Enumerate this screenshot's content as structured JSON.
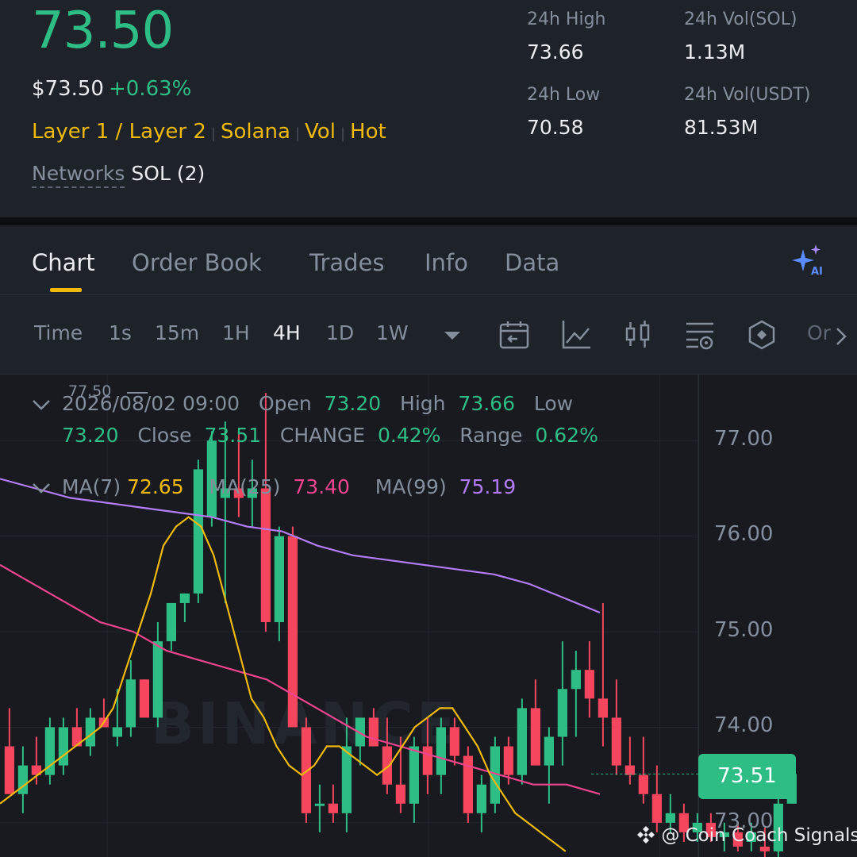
{
  "header": {
    "price": "73.50",
    "price_usd": "$73.50",
    "change_pct": "+0.63%",
    "tags": [
      "Layer 1 / Layer 2",
      "Solana",
      "Vol",
      "Hot"
    ],
    "tag_separator": "|",
    "networks_label": "Networks",
    "networks_value": "SOL (2)",
    "stats": {
      "high_label": "24h High",
      "high_value": "73.66",
      "low_label": "24h Low",
      "low_value": "70.58",
      "vol_sol_label": "24h Vol(SOL)",
      "vol_sol_value": "1.13M",
      "vol_usdt_label": "24h Vol(USDT)",
      "vol_usdt_value": "81.53M"
    }
  },
  "tabs": [
    "Chart",
    "Order Book",
    "Trades",
    "Info",
    "Data"
  ],
  "active_tab": "Chart",
  "timeframes": {
    "label": "Time",
    "items": [
      "1s",
      "15m",
      "1H",
      "4H",
      "1D",
      "1W"
    ],
    "active": "4H",
    "more": "Or"
  },
  "tool_icons": [
    "calendar-icon",
    "line-chart-icon",
    "candle-icon",
    "indicator-settings-icon",
    "hexagon-icon"
  ],
  "ohlc": {
    "date": "2026/08/02 09:00",
    "open_label": "Open",
    "open": "73.20",
    "high_label": "High",
    "high": "73.66",
    "low_label": "Low",
    "low": "73.20",
    "close_label": "Close",
    "close": "73.51",
    "change_label": "CHANGE",
    "change": "0.42%",
    "range_label": "Range",
    "range": "0.62%"
  },
  "ma": {
    "ma7_label": "MA(7)",
    "ma7": "72.65",
    "ma25_label": "MA(25)",
    "ma25": "73.40",
    "ma99_label": "MA(99)",
    "ma99": "75.19"
  },
  "colors": {
    "up": "#2ebd85",
    "down": "#f6465d",
    "accent": "#f0b90b",
    "ma7": "#f0b90b",
    "ma25": "#f0448e",
    "ma99": "#b27cf7",
    "background": "#1e2329",
    "chart_bg": "#181a20"
  },
  "watermark": "BINANCE",
  "credit": "@ Coin Coach Signals",
  "chart_data": {
    "type": "candlestick",
    "y_axis_ticks": [
      "77.00",
      "76.00",
      "75.00",
      "74.00",
      "73.00"
    ],
    "ylim": [
      72.7,
      77.7
    ],
    "high_marker": "77.50",
    "current_price": "73.51",
    "candles": [
      {
        "o": 73.8,
        "h": 74.2,
        "l": 73.3,
        "c": 73.3
      },
      {
        "o": 73.3,
        "h": 73.8,
        "l": 73.1,
        "c": 73.6
      },
      {
        "o": 73.6,
        "h": 73.9,
        "l": 73.4,
        "c": 73.5
      },
      {
        "o": 73.5,
        "h": 74.1,
        "l": 73.4,
        "c": 74.0
      },
      {
        "o": 73.6,
        "h": 74.1,
        "l": 73.5,
        "c": 74.0
      },
      {
        "o": 74.0,
        "h": 74.2,
        "l": 73.8,
        "c": 73.8
      },
      {
        "o": 73.8,
        "h": 74.2,
        "l": 73.7,
        "c": 74.1
      },
      {
        "o": 74.1,
        "h": 74.3,
        "l": 74.0,
        "c": 74.0
      },
      {
        "o": 73.9,
        "h": 74.4,
        "l": 73.8,
        "c": 74.0
      },
      {
        "o": 74.0,
        "h": 74.7,
        "l": 73.9,
        "c": 74.5
      },
      {
        "o": 74.5,
        "h": 74.5,
        "l": 74.1,
        "c": 74.1
      },
      {
        "o": 74.1,
        "h": 75.1,
        "l": 74.0,
        "c": 74.9
      },
      {
        "o": 74.9,
        "h": 75.3,
        "l": 74.8,
        "c": 75.3
      },
      {
        "o": 75.3,
        "h": 75.4,
        "l": 75.1,
        "c": 75.4
      },
      {
        "o": 75.4,
        "h": 76.8,
        "l": 75.3,
        "c": 76.7
      },
      {
        "o": 76.2,
        "h": 77.1,
        "l": 76.1,
        "c": 77.0
      },
      {
        "o": 76.4,
        "h": 77.2,
        "l": 75.3,
        "c": 76.5
      },
      {
        "o": 76.5,
        "h": 77.1,
        "l": 76.2,
        "c": 76.4
      },
      {
        "o": 76.4,
        "h": 76.8,
        "l": 76.1,
        "c": 76.5
      },
      {
        "o": 76.5,
        "h": 77.5,
        "l": 75.0,
        "c": 75.1
      },
      {
        "o": 75.1,
        "h": 76.1,
        "l": 74.9,
        "c": 76.0
      },
      {
        "o": 76.0,
        "h": 76.1,
        "l": 74.0,
        "c": 74.0
      },
      {
        "o": 74.0,
        "h": 74.1,
        "l": 73.0,
        "c": 73.1
      },
      {
        "o": 73.2,
        "h": 73.4,
        "l": 72.9,
        "c": 73.2
      },
      {
        "o": 73.2,
        "h": 73.4,
        "l": 73.0,
        "c": 73.1
      },
      {
        "o": 73.1,
        "h": 74.1,
        "l": 72.9,
        "c": 73.8
      },
      {
        "o": 73.8,
        "h": 74.1,
        "l": 73.6,
        "c": 74.1
      },
      {
        "o": 74.1,
        "h": 74.2,
        "l": 73.8,
        "c": 73.8
      },
      {
        "o": 73.8,
        "h": 74.1,
        "l": 73.3,
        "c": 73.4
      },
      {
        "o": 73.4,
        "h": 73.9,
        "l": 73.1,
        "c": 73.2
      },
      {
        "o": 73.2,
        "h": 73.9,
        "l": 73.0,
        "c": 73.8
      },
      {
        "o": 73.8,
        "h": 74.1,
        "l": 73.3,
        "c": 73.5
      },
      {
        "o": 73.5,
        "h": 74.1,
        "l": 73.3,
        "c": 74.0
      },
      {
        "o": 74.0,
        "h": 74.1,
        "l": 73.6,
        "c": 73.7
      },
      {
        "o": 73.7,
        "h": 73.8,
        "l": 73.0,
        "c": 73.1
      },
      {
        "o": 73.1,
        "h": 73.5,
        "l": 72.9,
        "c": 73.4
      },
      {
        "o": 73.2,
        "h": 73.9,
        "l": 73.1,
        "c": 73.8
      },
      {
        "o": 73.8,
        "h": 73.9,
        "l": 73.4,
        "c": 73.5
      },
      {
        "o": 73.5,
        "h": 74.3,
        "l": 73.4,
        "c": 74.2
      },
      {
        "o": 74.2,
        "h": 74.5,
        "l": 73.6,
        "c": 73.6
      },
      {
        "o": 73.6,
        "h": 74.0,
        "l": 73.2,
        "c": 73.9
      },
      {
        "o": 73.9,
        "h": 74.9,
        "l": 73.6,
        "c": 74.4
      },
      {
        "o": 74.4,
        "h": 74.8,
        "l": 73.9,
        "c": 74.6
      },
      {
        "o": 74.6,
        "h": 74.9,
        "l": 74.1,
        "c": 74.3
      },
      {
        "o": 74.3,
        "h": 75.3,
        "l": 73.8,
        "c": 74.1
      },
      {
        "o": 74.1,
        "h": 74.5,
        "l": 73.5,
        "c": 73.6
      },
      {
        "o": 73.6,
        "h": 73.9,
        "l": 73.4,
        "c": 73.5
      },
      {
        "o": 73.5,
        "h": 73.9,
        "l": 73.2,
        "c": 73.3
      },
      {
        "o": 73.3,
        "h": 73.6,
        "l": 72.9,
        "c": 73.0
      },
      {
        "o": 73.0,
        "h": 73.3,
        "l": 72.9,
        "c": 73.1
      },
      {
        "o": 73.1,
        "h": 73.2,
        "l": 72.8,
        "c": 72.9
      },
      {
        "o": 72.9,
        "h": 73.1,
        "l": 72.8,
        "c": 73.0
      },
      {
        "o": 73.0,
        "h": 73.1,
        "l": 72.8,
        "c": 72.85
      },
      {
        "o": 72.85,
        "h": 73.0,
        "l": 72.7,
        "c": 72.9
      },
      {
        "o": 72.9,
        "h": 73.0,
        "l": 72.7,
        "c": 72.75
      },
      {
        "o": 72.8,
        "h": 73.0,
        "l": 72.7,
        "c": 72.9
      },
      {
        "o": 72.75,
        "h": 72.95,
        "l": 72.6,
        "c": 72.7
      },
      {
        "o": 72.7,
        "h": 73.4,
        "l": 72.6,
        "c": 73.2
      },
      {
        "o": 73.2,
        "h": 73.66,
        "l": 73.2,
        "c": 73.51
      }
    ],
    "ma7": [
      73.2,
      73.3,
      73.4,
      73.5,
      73.6,
      73.7,
      73.8,
      73.9,
      74.0,
      74.2,
      74.6,
      75.0,
      75.4,
      75.9,
      76.1,
      76.2,
      76.1,
      75.8,
      75.3,
      74.8,
      74.3,
      74.1,
      73.8,
      73.6,
      73.5,
      73.6,
      73.8,
      73.8,
      73.7,
      73.6,
      73.5,
      73.6,
      73.8,
      74.0,
      74.1,
      74.2,
      74.2,
      74.0,
      73.8,
      73.5,
      73.3,
      73.1,
      73.0,
      72.9,
      72.8,
      72.7
    ],
    "ma25": [
      75.7,
      75.5,
      75.3,
      75.1,
      75.0,
      74.8,
      74.7,
      74.6,
      74.5,
      74.3,
      74.1,
      73.9,
      73.8,
      73.7,
      73.6,
      73.5,
      73.4,
      73.4,
      73.3
    ],
    "ma99": [
      76.6,
      76.5,
      76.4,
      76.35,
      76.3,
      76.25,
      76.2,
      76.1,
      76.05,
      75.9,
      75.8,
      75.75,
      75.7,
      75.65,
      75.6,
      75.5,
      75.35,
      75.2
    ]
  }
}
